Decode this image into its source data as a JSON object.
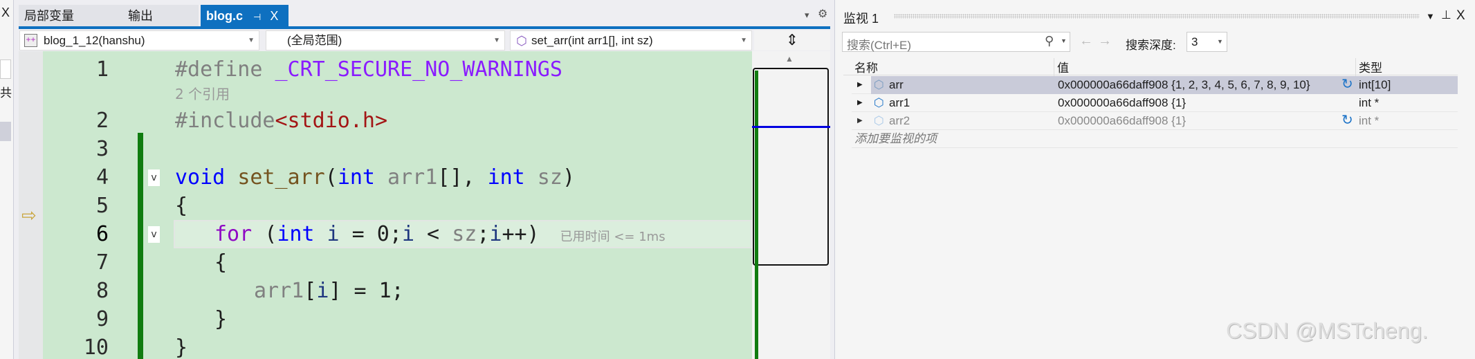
{
  "tabs": [
    {
      "label": "局部变量"
    },
    {
      "label": "输出"
    },
    {
      "label": "blog.c",
      "pin": "⊣",
      "close": "X"
    }
  ],
  "tab_overflow": "▾",
  "settings": "⚙",
  "nav": {
    "project": "blog_1_12(hanshu)",
    "scope": "(全局范围)",
    "member": "set_arr(int arr1[], int sz)"
  },
  "code": {
    "lines": [
      "1",
      "2",
      "3",
      "4",
      "5",
      "6",
      "7",
      "8",
      "9",
      "10"
    ],
    "codelens": "2 个引用",
    "perf_tip": "已用时间 <= 1ms",
    "l1a": "#define ",
    "l1b": "_CRT_SECURE_NO_WARNINGS",
    "l2a": "#include",
    "l2b": "<stdio.h>",
    "l4": [
      "void",
      " ",
      "set_arr",
      "(",
      "int",
      " arr1",
      "[], ",
      "int",
      " sz",
      ")"
    ],
    "l5": "{",
    "l6": [
      "for",
      " (",
      "int",
      " i",
      " = 0;",
      "i",
      " < ",
      "sz",
      ";",
      "i",
      "++)"
    ],
    "l7": "{",
    "l8": [
      "arr1",
      "[",
      "i",
      "] = 1;"
    ],
    "l9": "}",
    "l10": "}"
  },
  "watch": {
    "title": "监视 1",
    "search_placeholder": "搜索(Ctrl+E)",
    "depth_label": "搜索深度:",
    "depth": "3",
    "columns": [
      "名称",
      "值",
      "类型"
    ],
    "rows": [
      {
        "name": "arr",
        "value": "0x000000a66daff908 {1, 2, 3, 4, 5, 6, 7, 8, 9, 10}",
        "type": "int[10]"
      },
      {
        "name": "arr1",
        "value": "0x000000a66daff908 {1}",
        "type": "int *"
      },
      {
        "name": "arr2",
        "value": "0x000000a66daff908 {1}",
        "type": "int *"
      }
    ],
    "add_item": "添加要监视的项"
  },
  "left_strip": {
    "close": "X",
    "char": "共"
  },
  "watermark": "CSDN @MSTcheng."
}
